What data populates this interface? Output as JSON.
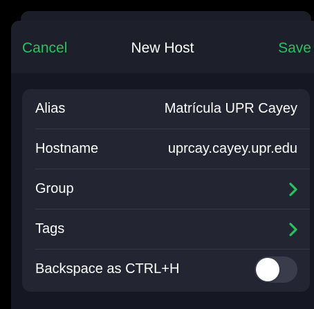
{
  "nav": {
    "cancel_label": "Cancel",
    "title": "New Host",
    "save_label": "Save"
  },
  "form": {
    "alias": {
      "label": "Alias",
      "value": "Matrícula UPR Cayey"
    },
    "hostname": {
      "label": "Hostname",
      "value": "uprcay.cayey.upr.edu"
    },
    "group": {
      "label": "Group",
      "icon": "chevron-right-icon"
    },
    "tags": {
      "label": "Tags",
      "icon": "chevron-right-icon"
    },
    "backspace": {
      "label": "Backspace as CTRL+H",
      "enabled": false
    }
  },
  "colors": {
    "accent": "#22c55e",
    "background": "#151722",
    "card": "#232533",
    "toggle_off": "#3a3c4b"
  }
}
